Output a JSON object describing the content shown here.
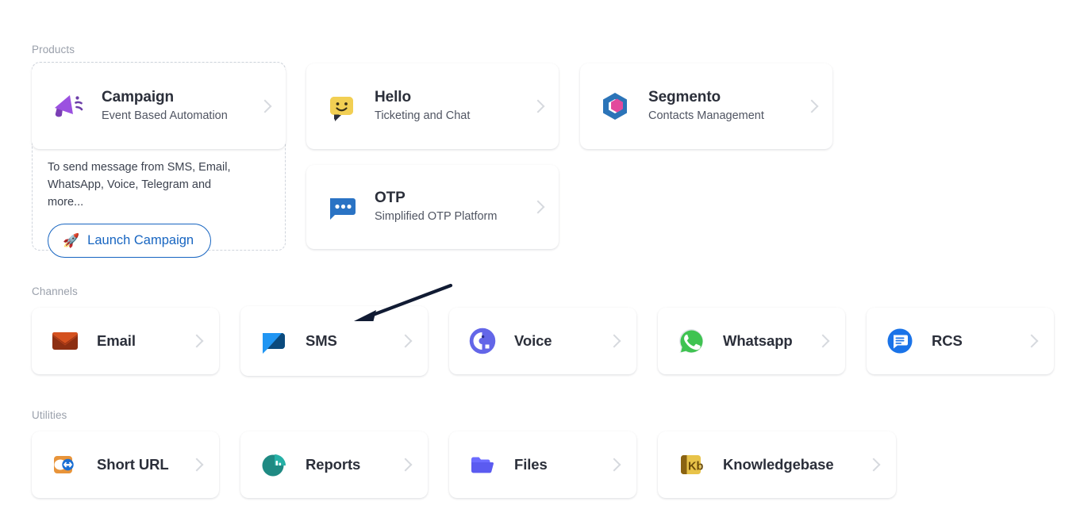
{
  "sections": {
    "products": {
      "label": "Products"
    },
    "channels": {
      "label": "Channels"
    },
    "utilities": {
      "label": "Utilities"
    }
  },
  "products": [
    {
      "id": "campaign",
      "title": "Campaign",
      "subtitle": "Event Based Automation",
      "icon": "megaphone-icon",
      "color": "#9b51e0"
    },
    {
      "id": "hello",
      "title": "Hello",
      "subtitle": "Ticketing and Chat",
      "icon": "smiley-chat-icon",
      "color": "#f2cf53"
    },
    {
      "id": "segmento",
      "title": "Segmento",
      "subtitle": "Contacts Management",
      "icon": "hexagon-icon",
      "color": "#2b74b8"
    },
    {
      "id": "otp",
      "title": "OTP",
      "subtitle": "Simplified OTP Platform",
      "icon": "chat-dots-icon",
      "color": "#2a73c4"
    }
  ],
  "campaign_promo": {
    "description": "To send message from SMS, Email, WhatsApp, Voice, Telegram and more...",
    "button_label": "Launch Campaign",
    "button_icon": "rocket-icon",
    "button_color": "#1765c1"
  },
  "channels": [
    {
      "id": "email",
      "title": "Email",
      "icon": "envelope-icon",
      "color": "#c1441d"
    },
    {
      "id": "sms",
      "title": "SMS",
      "icon": "sms-bubble-icon",
      "color": "#2196f3"
    },
    {
      "id": "voice",
      "title": "Voice",
      "icon": "voice-circle-icon",
      "color": "#6366e8"
    },
    {
      "id": "whatsapp",
      "title": "Whatsapp",
      "icon": "whatsapp-icon",
      "color": "#3fc351"
    },
    {
      "id": "rcs",
      "title": "RCS",
      "icon": "rcs-message-icon",
      "color": "#1a73e8"
    }
  ],
  "utilities": [
    {
      "id": "short-url",
      "title": "Short URL",
      "icon": "short-url-icon",
      "color": "#e8943a"
    },
    {
      "id": "reports",
      "title": "Reports",
      "icon": "pie-chart-icon",
      "color": "#1f8a83"
    },
    {
      "id": "files",
      "title": "Files",
      "icon": "folder-icon",
      "color": "#5b5bf0"
    },
    {
      "id": "knowledgebase",
      "title": "Knowledgebase",
      "icon": "book-kb-icon",
      "color": "#e8c349"
    }
  ],
  "annotation": {
    "arrow_color": "#111b33",
    "points_to": "sms"
  }
}
